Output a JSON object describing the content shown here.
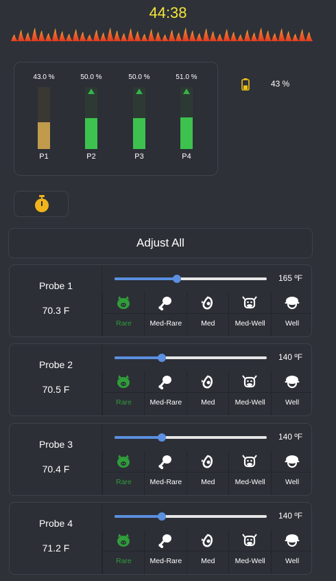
{
  "header": {
    "timer": "44:38"
  },
  "probes_summary": [
    {
      "label": "P1",
      "percent_text": "43.0 %",
      "fill": 0.43,
      "color": "#c19a4c",
      "track": "#3a3833",
      "rising": false
    },
    {
      "label": "P2",
      "percent_text": "50.0 %",
      "fill": 0.5,
      "color": "#3dc24f",
      "track": "#2d3a33",
      "rising": true
    },
    {
      "label": "P3",
      "percent_text": "50.0 %",
      "fill": 0.5,
      "color": "#3dc24f",
      "track": "#2d3a33",
      "rising": true
    },
    {
      "label": "P4",
      "percent_text": "51.0 %",
      "fill": 0.51,
      "color": "#3dc24f",
      "track": "#2d3a33",
      "rising": true
    }
  ],
  "battery": {
    "percent_text": "43 %",
    "level": 0.43,
    "color": "#f0c419"
  },
  "controls": {
    "stopwatch_icon": "stopwatch-icon",
    "adjust_all_label": "Adjust All"
  },
  "doneness_labels": [
    "Rare",
    "Med-Rare",
    "Med",
    "Med-Well",
    "Well"
  ],
  "doneness_icons": [
    "pig-icon",
    "chicken-leg-icon",
    "fish-icon",
    "cow-icon",
    "sheep-icon"
  ],
  "probes": [
    {
      "name": "Probe 1",
      "temp": "70.3 F",
      "target": "165 ºF",
      "slider": 0.41,
      "selected": 0
    },
    {
      "name": "Probe 2",
      "temp": "70.5 F",
      "target": "140 ºF",
      "slider": 0.31,
      "selected": 0
    },
    {
      "name": "Probe 3",
      "temp": "70.4 F",
      "target": "140 ºF",
      "slider": 0.31,
      "selected": 0
    },
    {
      "name": "Probe 4",
      "temp": "71.2 F",
      "target": "140 ºF",
      "slider": 0.31,
      "selected": 0
    }
  ],
  "colors": {
    "accent": "#5b8fe0",
    "active": "#2f9d3a",
    "timer": "#f5e63a",
    "background": "#2e3138"
  }
}
